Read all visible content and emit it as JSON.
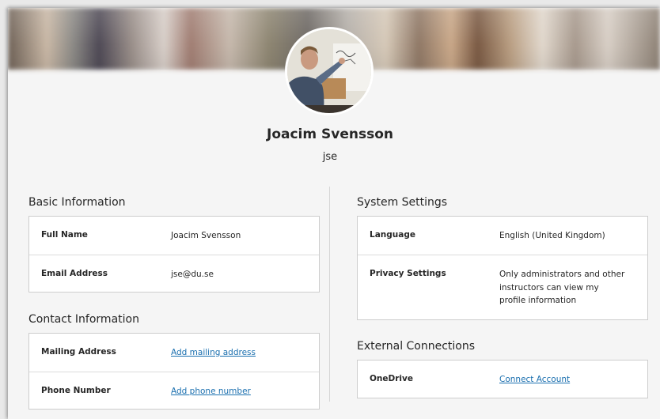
{
  "profile": {
    "name": "Joacim Svensson",
    "username": "jse"
  },
  "basic_info": {
    "title": "Basic Information",
    "rows": [
      {
        "label": "Full Name",
        "value": "Joacim Svensson"
      },
      {
        "label": "Email Address",
        "value": "jse@du.se"
      }
    ]
  },
  "contact_info": {
    "title": "Contact Information",
    "rows": [
      {
        "label": "Mailing Address",
        "value": "Add mailing address"
      },
      {
        "label": "Phone Number",
        "value": "Add phone number"
      }
    ]
  },
  "system_settings": {
    "title": "System Settings",
    "rows": [
      {
        "label": "Language",
        "value": "English (United Kingdom)"
      },
      {
        "label": "Privacy Settings",
        "value": "Only administrators and other instructors can view my profile information"
      }
    ]
  },
  "external_connections": {
    "title": "External Connections",
    "rows": [
      {
        "label": "OneDrive",
        "value": "Connect Account"
      }
    ]
  },
  "colors": {
    "link": "#1a6faf",
    "page_background": "#f5f5f5",
    "card_background": "#ffffff",
    "border": "#cdcdcd"
  }
}
